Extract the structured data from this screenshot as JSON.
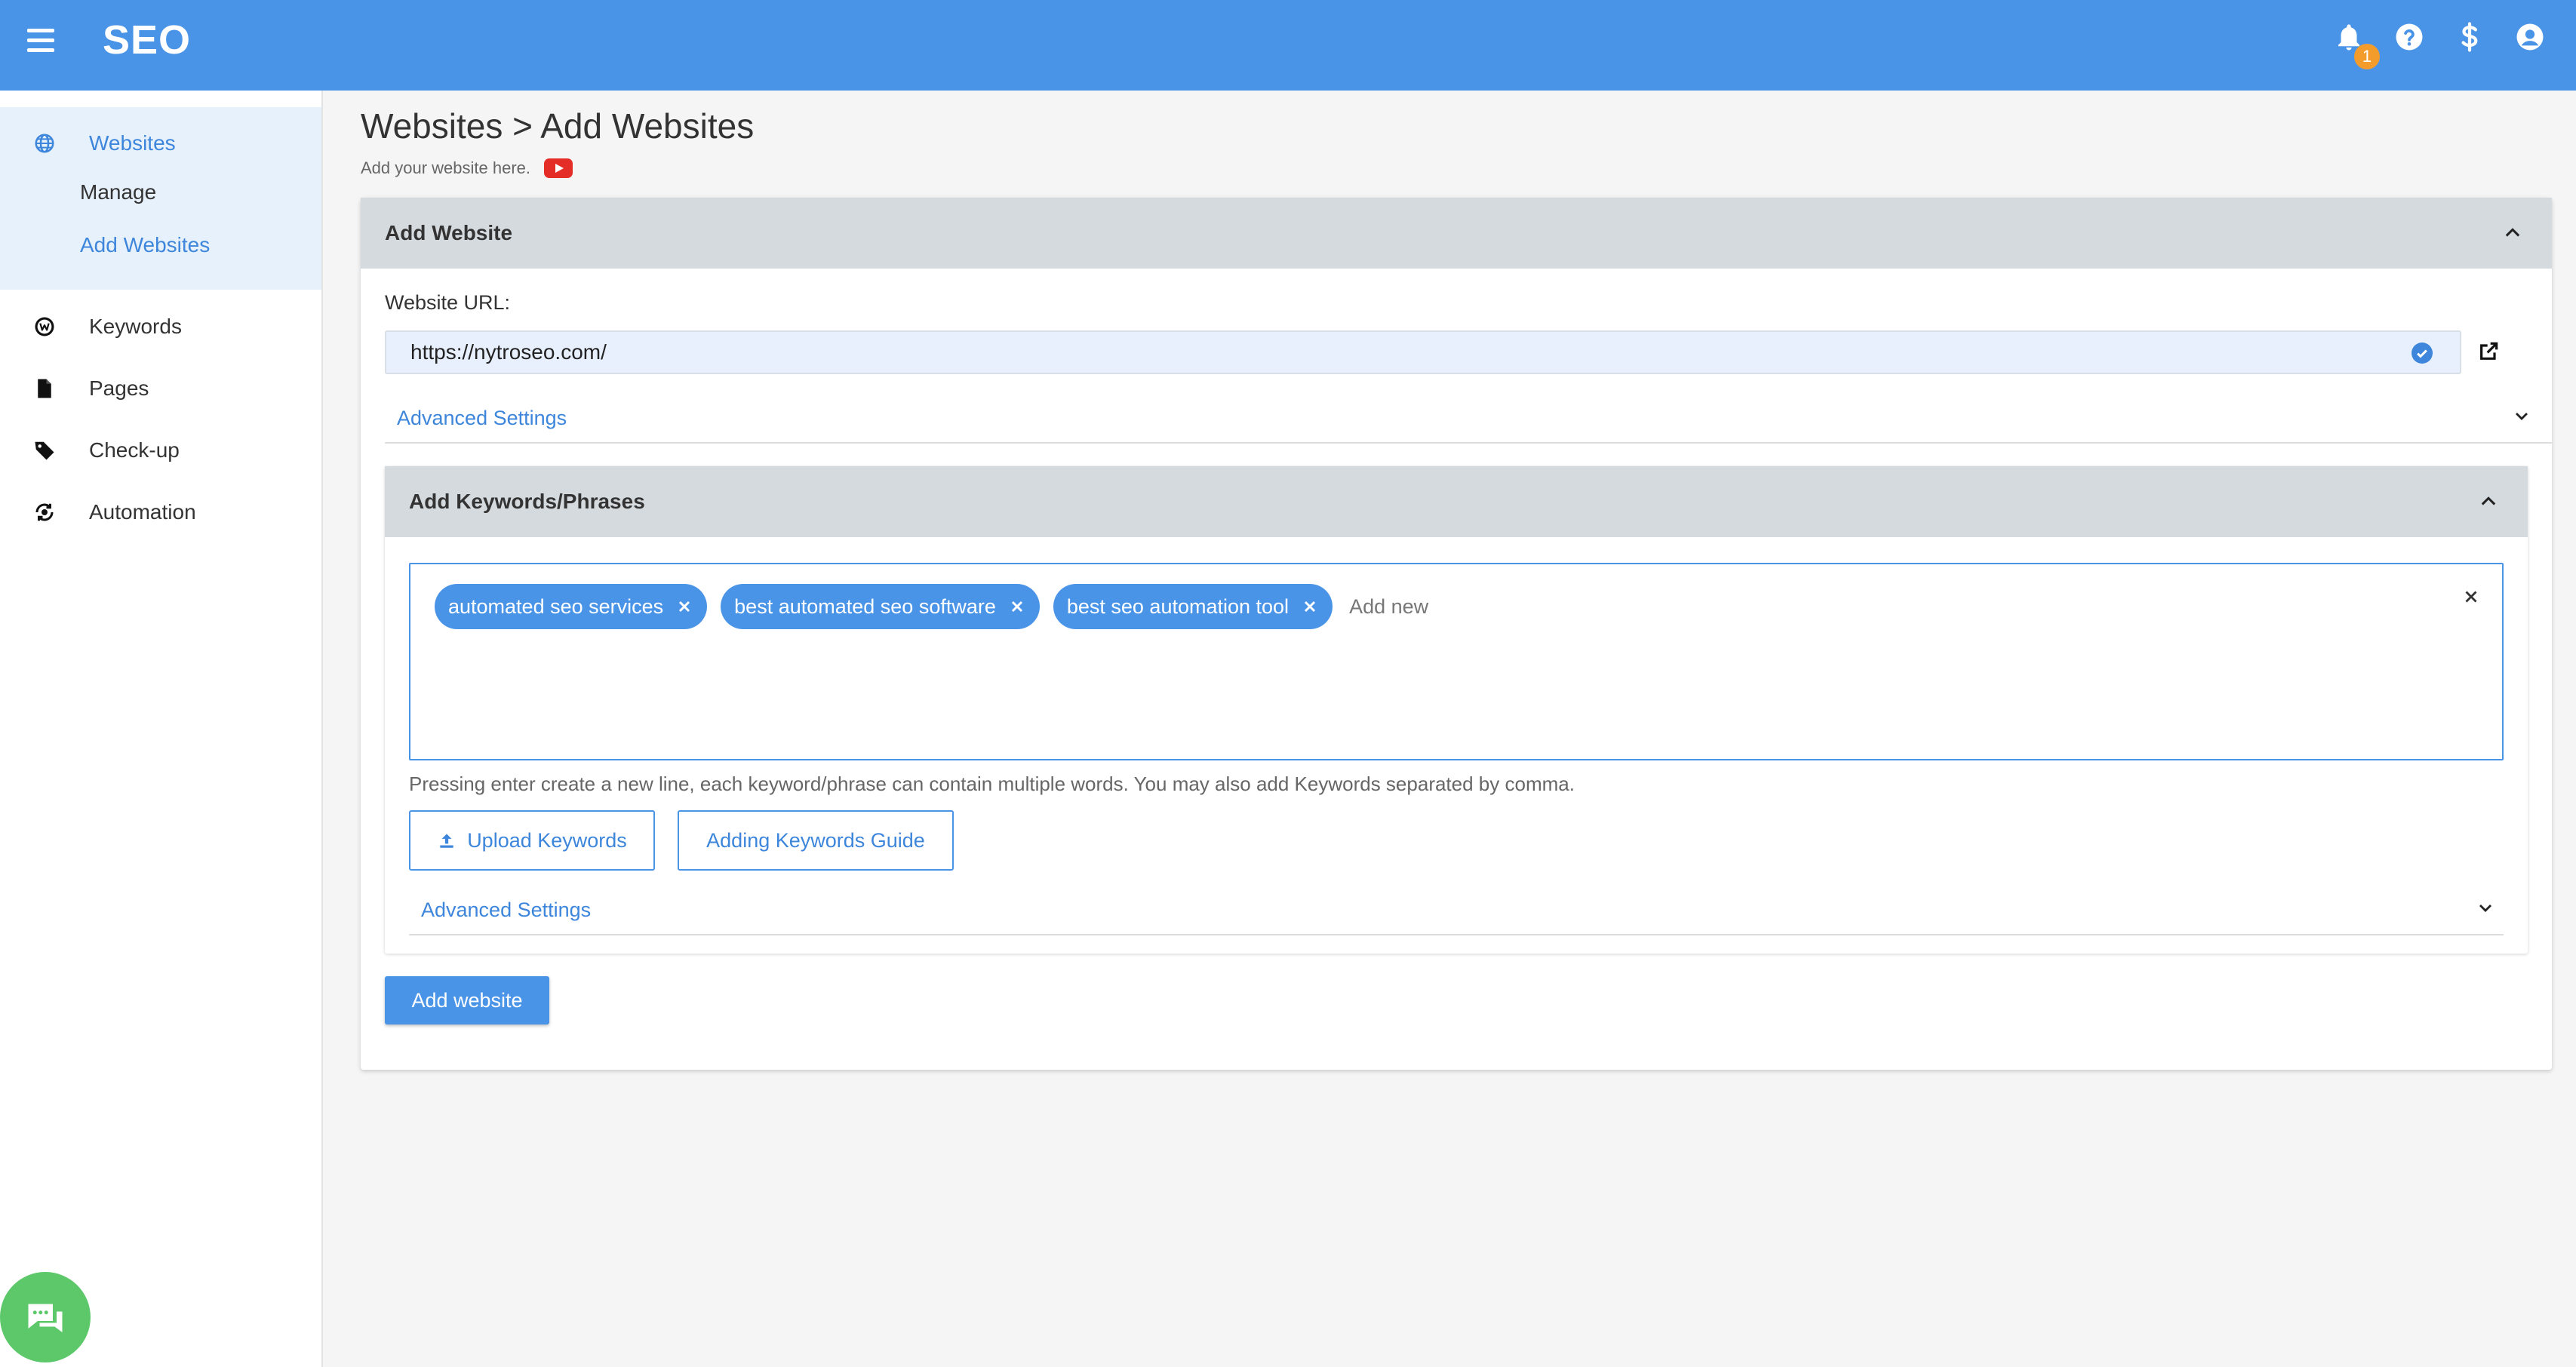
{
  "app": {
    "brand": "SEO",
    "notification_count": "1"
  },
  "sidebar": {
    "items": [
      {
        "label": "Websites",
        "icon": "globe-icon"
      },
      {
        "label": "Manage"
      },
      {
        "label": "Add Websites"
      },
      {
        "label": "Keywords",
        "icon": "keyword-icon"
      },
      {
        "label": "Pages",
        "icon": "document-icon"
      },
      {
        "label": "Check-up",
        "icon": "tag-icon"
      },
      {
        "label": "Automation",
        "icon": "automation-icon"
      }
    ]
  },
  "header": {
    "breadcrumb_parent": "Websites",
    "breadcrumb_sep": ">",
    "breadcrumb_current": "Add Websites",
    "subtitle": "Add your website here."
  },
  "add_website": {
    "title": "Add Website",
    "url_label": "Website URL:",
    "url_value": "https://nytroseo.com/",
    "advanced_settings": "Advanced Settings"
  },
  "keywords": {
    "title": "Add Keywords/Phrases",
    "chips": [
      "automated seo services",
      "best automated seo software",
      "best seo automation tool"
    ],
    "add_placeholder": "Add new",
    "hint": "Pressing enter create a new line, each keyword/phrase can contain multiple words. You may also add Keywords separated by comma.",
    "upload_button": "Upload Keywords",
    "guide_button": "Adding Keywords Guide",
    "advanced_settings": "Advanced Settings"
  },
  "actions": {
    "submit": "Add website"
  },
  "colors": {
    "primary": "#4a94e8",
    "accent": "#3d86db",
    "badge": "#f49c2b",
    "chat": "#5cc86a"
  }
}
